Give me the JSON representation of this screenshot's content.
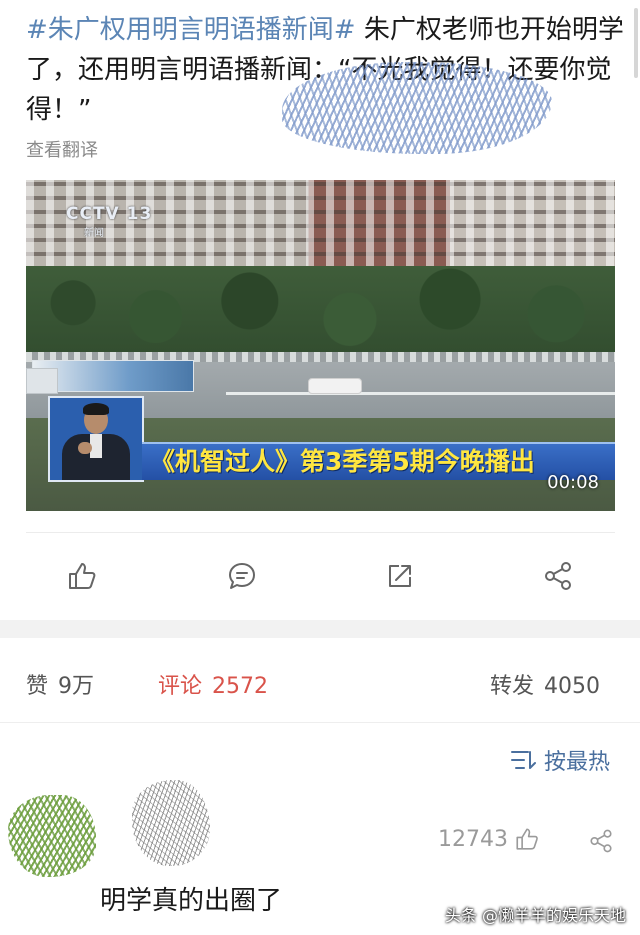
{
  "post": {
    "hashtag": "#朱广权用明言明语播新闻#",
    "text": " 朱广权老师也开始明学了，还用明言明语播新闻：“不光我觉得！还要你觉得！”",
    "translate_label": "查看翻译"
  },
  "video": {
    "channel_logo": "CCTV 13",
    "channel_sub": "新闻",
    "banner": "《机智过人》第3季第5期今晚播出",
    "timecode": "00:08"
  },
  "actions": {
    "icons": [
      "thumb-up-icon",
      "comment-icon",
      "repost-icon",
      "share-icon"
    ]
  },
  "stats": {
    "likes_label": "赞",
    "likes_value": "9万",
    "comments_label": "评论",
    "comments_value": "2572",
    "reposts_label": "转发",
    "reposts_value": "4050"
  },
  "sort": {
    "label": "按最热"
  },
  "comment": {
    "like_count": "12743",
    "text": "明学真的出圈了"
  },
  "watermark": "头条 @懒羊羊的娱乐天地",
  "colors": {
    "hashtag": "#5b85b5",
    "comments_active": "#d9534a",
    "sort": "#4a6f9e",
    "banner_bg": "#2450a5",
    "banner_text": "#ffe640"
  }
}
